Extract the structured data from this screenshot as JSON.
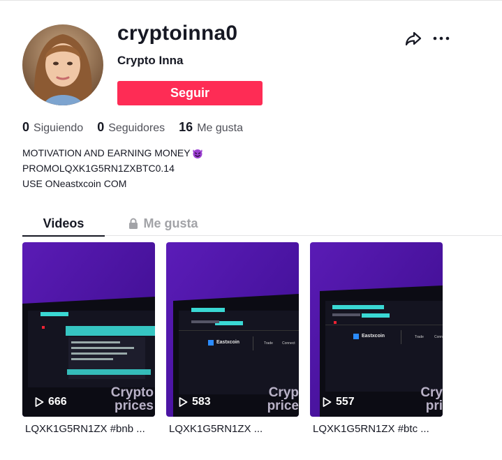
{
  "profile": {
    "username": "cryptoinna0",
    "nickname": "Crypto Inna",
    "follow_label": "Seguir"
  },
  "icons": {
    "share": "share-arrow-icon",
    "more": "more-dots-icon",
    "lock": "lock-icon",
    "play": "play-icon",
    "emoji": "smiling-devil-emoji"
  },
  "stats": [
    {
      "value": "0",
      "label": "Siguiendo"
    },
    {
      "value": "0",
      "label": "Seguidores"
    },
    {
      "value": "16",
      "label": "Me gusta"
    }
  ],
  "bio": {
    "line1": "MOTIVATION AND EARNING MONEY",
    "line2_a": "PROMO ",
    "line2_b": "LQXK1G5RN1ZX",
    "line2_c": " BTC",
    "line2_d": "0.14",
    "line3_a": "USE ON ",
    "line3_b": "eastxcoin",
    "line3_c": " COM"
  },
  "tabs": [
    {
      "label": "Videos",
      "active": true
    },
    {
      "label": "Me gusta",
      "active": false,
      "locked": true
    }
  ],
  "videos": [
    {
      "views": "666",
      "caption": "LQXK1G5RN1ZX #bnb ...",
      "overlay_text_1": "Crypto",
      "overlay_text_2": "prices"
    },
    {
      "views": "583",
      "caption": "LQXK1G5RN1ZX ...",
      "overlay_text_1": "Cryp",
      "overlay_text_2": "price",
      "site_name": "Eastxcoin",
      "menu_1": "Trade",
      "menu_2": "Connect"
    },
    {
      "views": "557",
      "caption": "LQXK1G5RN1ZX #btc ...",
      "overlay_text_1": "Cry",
      "overlay_text_2": "pri",
      "site_name": "Eastxcoin",
      "menu_1": "Trade",
      "menu_2": "Conn"
    }
  ],
  "colors": {
    "accent": "#fe2c55",
    "text": "#161823",
    "muted": "#a2a3a7"
  }
}
